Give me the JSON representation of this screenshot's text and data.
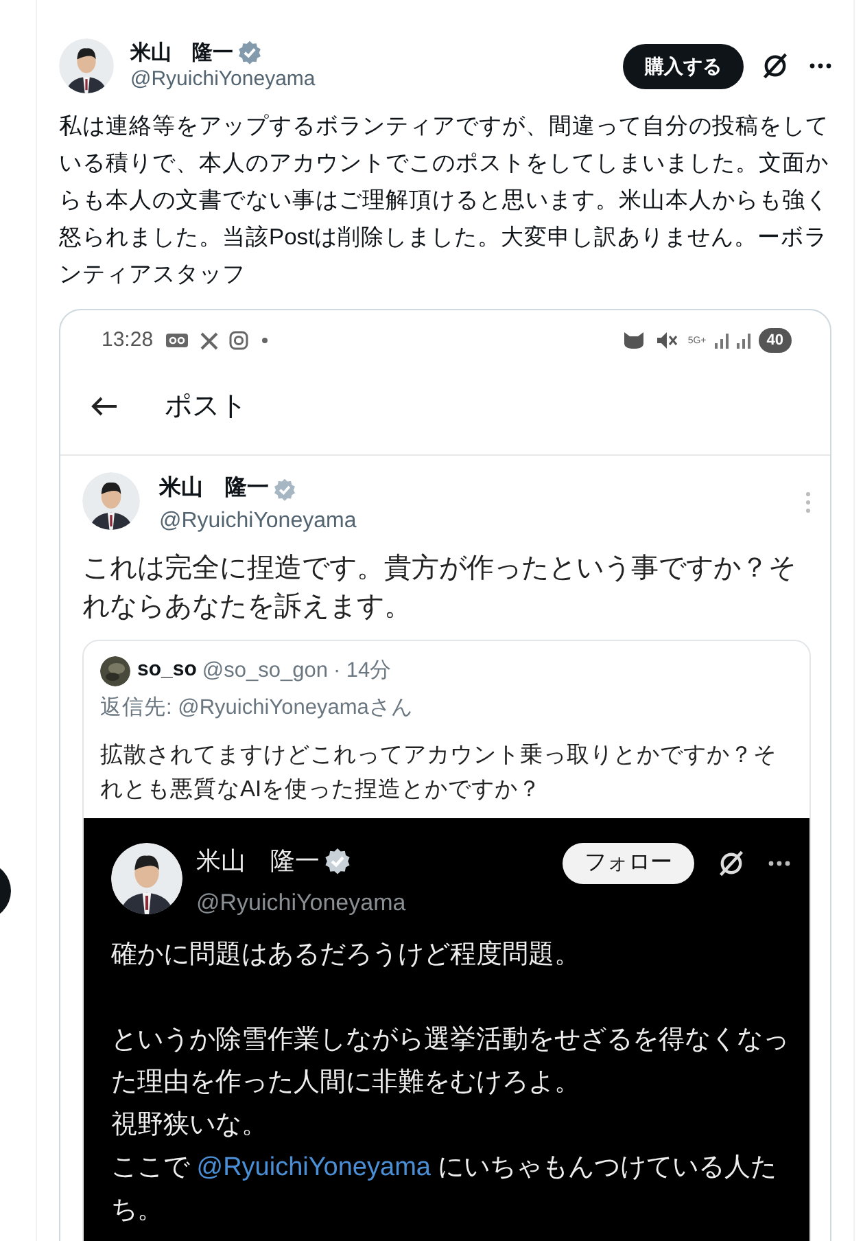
{
  "post": {
    "author": {
      "name": "米山　隆一",
      "verified": true,
      "handle": "@RyuichiYoneyama"
    },
    "buy_button": "購入する",
    "text": "私は連絡等をアップするボランティアですが、間違って自分の投稿をしている積りで、本人のアカウントでこのポストをしてしまいました。文面からも本人の文書でない事はご理解頂けると思います。米山本人からも強く怒られました。当該Postは削除しました。大変申し訳ありません。ーボランティアスタッフ",
    "attached_screenshot": {
      "status_bar": {
        "time": "13:28",
        "network": "5G+",
        "battery": "40"
      },
      "header": {
        "title": "ポスト"
      },
      "post": {
        "author": {
          "name": "米山　隆一",
          "verified": true,
          "handle": "@RyuichiYoneyama"
        },
        "text": "これは完全に捏造です。貴方が作ったという事ですか？それならあなたを訴えます。",
        "quoted": {
          "author": {
            "name": "so_so",
            "handle": "@so_so_gon",
            "time": "· 14分"
          },
          "reply_to": "返信先: @RyuichiYoneyamaさん",
          "text": "拡散されてますけどこれってアカウント乗っ取りとかですか？それとも悪質なAIを使った捏造とかですか？",
          "image": {
            "author": {
              "name": "米山　隆一",
              "verified": true,
              "handle": "@RyuichiYoneyama"
            },
            "follow_button": "フォロー",
            "paragraphs": [
              {
                "lines": [
                  [
                    {
                      "kind": "text",
                      "text": "確かに問題はあるだろうけど程度問題。"
                    }
                  ]
                ]
              },
              {
                "lines": [
                  [
                    {
                      "kind": "text",
                      "text": "というか除雪作業しながら選挙活動をせざるを得なくなった理由を作った人間に非難をむけろよ。"
                    }
                  ],
                  [
                    {
                      "kind": "text",
                      "text": "視野狭いな。"
                    }
                  ],
                  [
                    {
                      "kind": "text",
                      "text": "ここで "
                    },
                    {
                      "kind": "mention",
                      "text": "@RyuichiYoneyama"
                    },
                    {
                      "kind": "text",
                      "text": " にいちゃもんつけている人たち。"
                    }
                  ]
                ]
              }
            ]
          }
        }
      }
    }
  }
}
